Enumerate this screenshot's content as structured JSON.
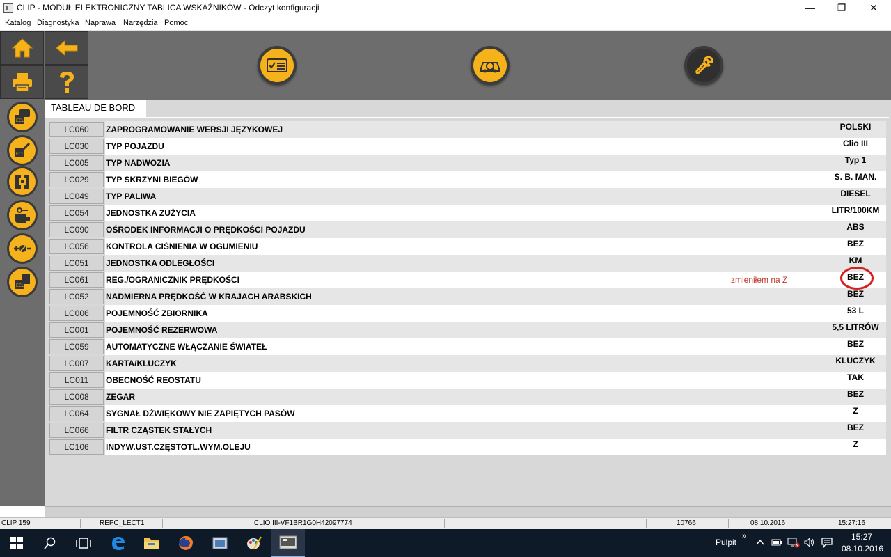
{
  "window": {
    "title": "CLIP - MODUŁ ELEKTRONICZNY TABLICA WSKAŹNIKÓW - Odczyt konfiguracji",
    "minimize": "—",
    "maximize": "❐",
    "close": "✕"
  },
  "menu": [
    "Katalog",
    "Diagnostyka",
    "Naprawa",
    "Narzędzia",
    "Pomoc"
  ],
  "tab": {
    "label": "TABLEAU DE BORD"
  },
  "rows": [
    {
      "code": "LC060",
      "desc": "ZAPROGRAMOWANIE WERSJI JĘZYKOWEJ",
      "value": "POLSKI"
    },
    {
      "code": "LC030",
      "desc": "TYP POJAZDU",
      "value": "Clio III"
    },
    {
      "code": "LC005",
      "desc": "TYP NADWOZIA",
      "value": "Typ 1"
    },
    {
      "code": "LC029",
      "desc": "TYP SKRZYNI BIEGÓW",
      "value": "S. B. MAN."
    },
    {
      "code": "LC049",
      "desc": "TYP PALIWA",
      "value": "DIESEL"
    },
    {
      "code": "LC054",
      "desc": "JEDNOSTKA ZUŻYCIA",
      "value": "LITR/100KM"
    },
    {
      "code": "LC090",
      "desc": "OŚRODEK INFORMACJI O PRĘDKOŚCI POJAZDU",
      "value": "ABS"
    },
    {
      "code": "LC056",
      "desc": "KONTROLA CIŚNIENIA W OGUMIENIU",
      "value": "BEZ"
    },
    {
      "code": "LC051",
      "desc": "JEDNOSTKA ODLEGŁOŚCI",
      "value": "KM"
    },
    {
      "code": "LC061",
      "desc": "REG./OGRANICZNIK PRĘDKOŚCI",
      "value": "BEZ"
    },
    {
      "code": "LC052",
      "desc": "NADMIERNA PRĘDKOŚĆ W KRAJACH ARABSKICH",
      "value": "BEZ"
    },
    {
      "code": "LC006",
      "desc": "POJEMNOŚĆ ZBIORNIKA",
      "value": "53 L"
    },
    {
      "code": "LC001",
      "desc": "POJEMNOŚĆ REZERWOWA",
      "value": "5,5 LITRÓW"
    },
    {
      "code": "LC059",
      "desc": "AUTOMATYCZNE WŁĄCZANIE ŚWIATEŁ",
      "value": "BEZ"
    },
    {
      "code": "LC007",
      "desc": "KARTA/KLUCZYK",
      "value": "KLUCZYK"
    },
    {
      "code": "LC011",
      "desc": "OBECNOŚĆ REOSTATU",
      "value": "TAK"
    },
    {
      "code": "LC008",
      "desc": "ZEGAR",
      "value": "BEZ"
    },
    {
      "code": "LC064",
      "desc": "SYGNAŁ DŹWIĘKOWY NIE ZAPIĘTYCH PASÓW",
      "value": "Z"
    },
    {
      "code": "LC066",
      "desc": "FILTR CZĄSTEK STAŁYCH",
      "value": "BEZ"
    },
    {
      "code": "LC106",
      "desc": "INDYW.UST.CZĘSTOTL.WYM.OLEJU",
      "value": "Z"
    }
  ],
  "annotation": {
    "text": "zmieniłem na Z",
    "color": "#c0392b"
  },
  "status": {
    "device": "CLIP 159",
    "mode": "REPC_LECT1",
    "vehicle": "CLIO III-VF1BR1G0H42097774",
    "number": "10766",
    "date": "08.10.2016",
    "time": "15:27:16"
  },
  "taskbar": {
    "desktop_label": "Pulpit",
    "desktop_chevron": "»",
    "clock_time": "15:27",
    "clock_date": "08.10.2016"
  },
  "icons": {
    "toolbar": [
      "home-icon",
      "back-arrow-icon",
      "printer-icon",
      "help-icon",
      "checklist-icon",
      "vehicle-diagnostic-icon",
      "wrench-icon"
    ],
    "sidebar": [
      "ecu-comment-icon",
      "ecu-edit-icon",
      "ecu-connector-icon",
      "engine-key-icon",
      "plus-minus-icon",
      "ecu-document-icon"
    ]
  },
  "colors": {
    "accent": "#f6b21b",
    "dark": "#3c3c3c",
    "panel": "#6d6d6d"
  }
}
